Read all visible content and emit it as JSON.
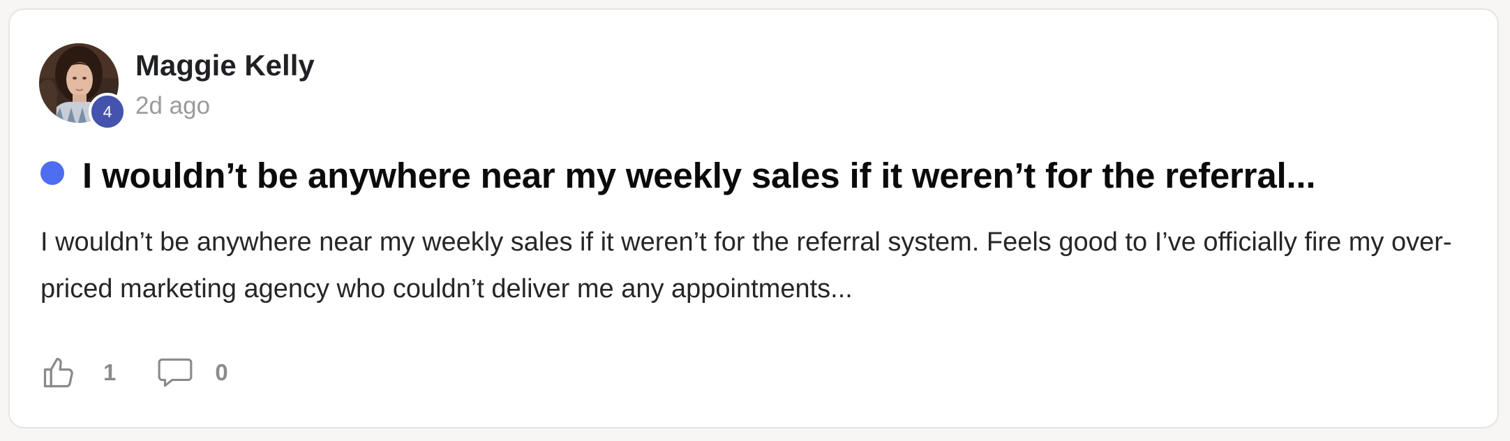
{
  "post": {
    "author": {
      "name": "Maggie Kelly",
      "level": "4",
      "avatar_icon": "user-avatar-photo"
    },
    "timestamp": "2d ago",
    "unread_dot_color": "#4e6df0",
    "title": "I wouldn’t be anywhere near my weekly sales if it weren’t for the referral...",
    "body": "I wouldn’t be anywhere near my weekly sales if it weren’t for the referral system. Feels good to I’ve officially fire my over-priced marketing agency who couldn’t deliver me any appointments...",
    "likes": "1",
    "comments": "0",
    "like_icon": "thumbs-up-icon",
    "comment_icon": "comment-bubble-icon"
  }
}
